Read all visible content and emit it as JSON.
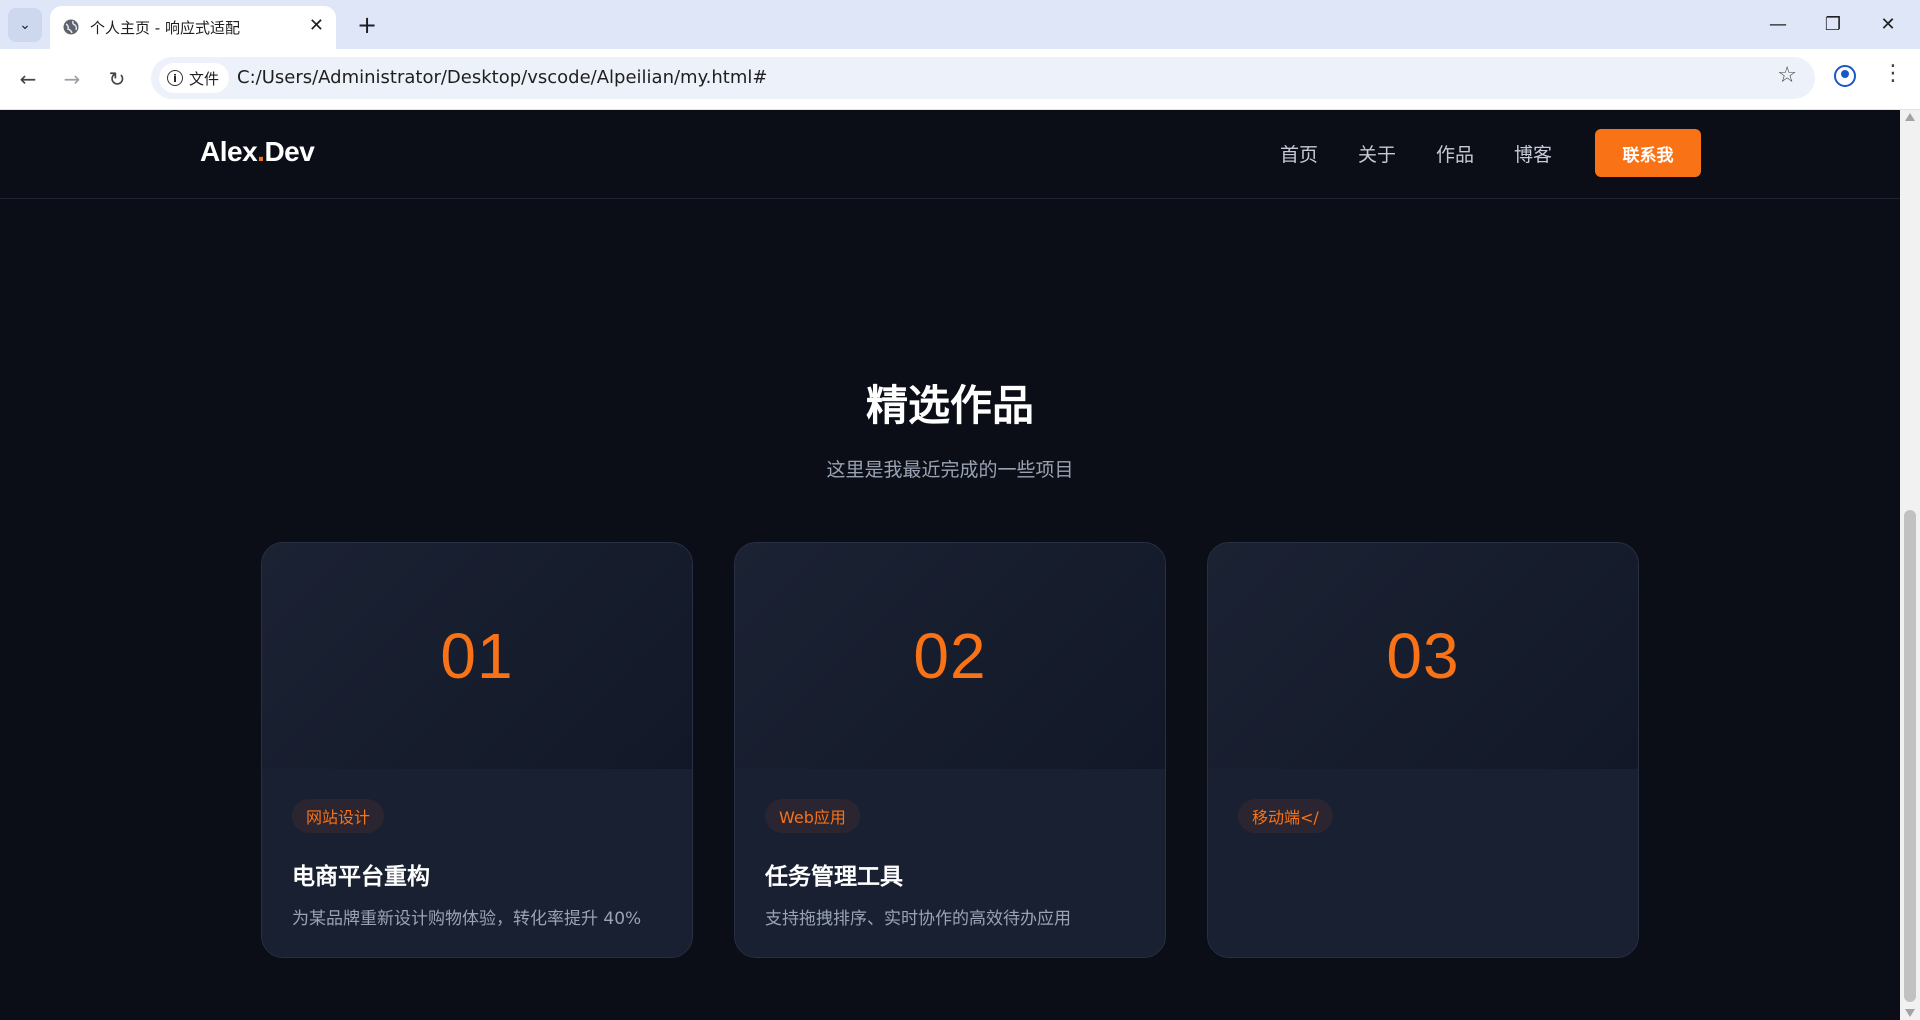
{
  "browser": {
    "tab_title": "个人主页 - 响应式适配",
    "site_chip_label": "文件",
    "url": "C:/Users/Administrator/Desktop/vscode/Alpeilian/my.html#"
  },
  "site": {
    "logo_main": "Alex",
    "logo_dot": ".",
    "logo_suffix": "Dev",
    "nav": [
      "首页",
      "关于",
      "作品",
      "博客"
    ],
    "cta": "联系我"
  },
  "works": {
    "title": "精选作品",
    "subtitle": "这里是我最近完成的一些项目",
    "cards": [
      {
        "number": "01",
        "tag": "网站设计",
        "title": "电商平台重构",
        "desc": "为某品牌重新设计购物体验，转化率提升 40%"
      },
      {
        "number": "02",
        "tag": "Web应用",
        "title": "任务管理工具",
        "desc": "支持拖拽排序、实时协作的高效待办应用"
      },
      {
        "number": "03",
        "tag": "移动端</",
        "title": "",
        "desc": ""
      }
    ]
  },
  "colors": {
    "accent": "#f97316",
    "background": "#0b0e16",
    "card": "#182031"
  }
}
